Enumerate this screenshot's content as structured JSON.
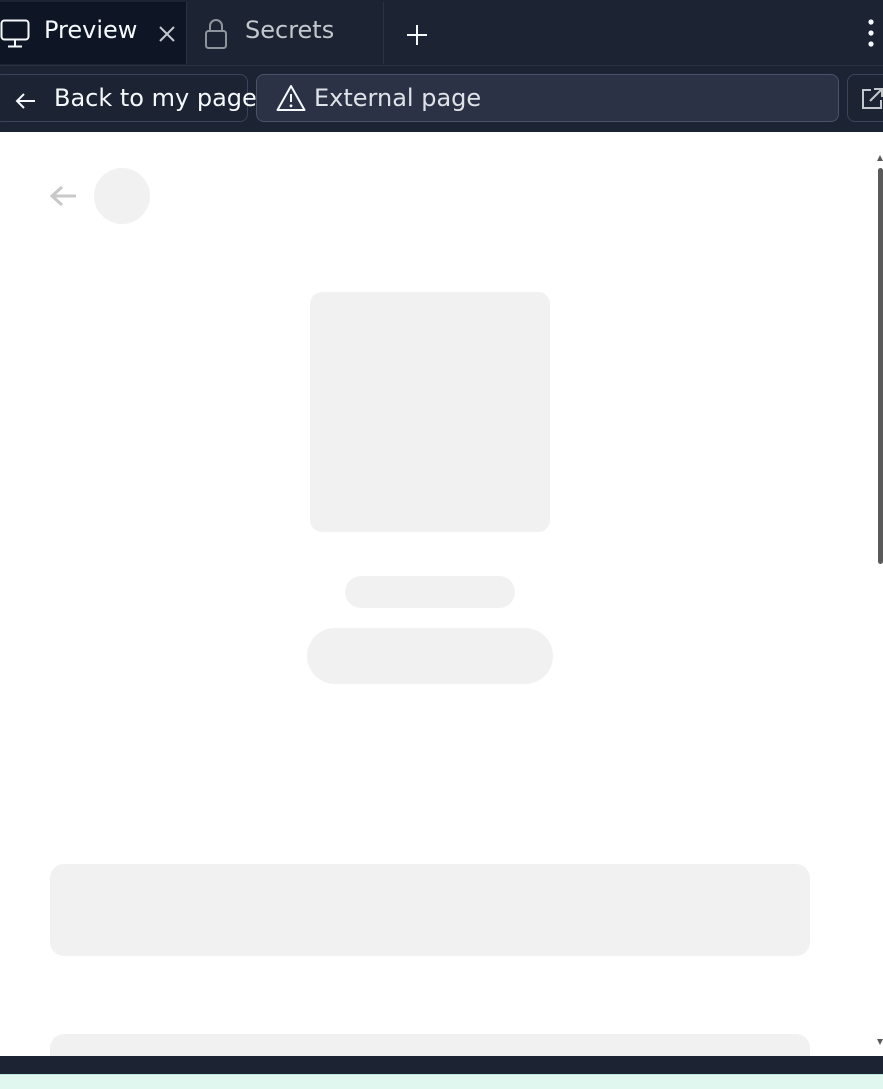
{
  "tabs": [
    {
      "label": "Preview",
      "icon": "monitor-icon",
      "active": true,
      "closable": true
    },
    {
      "label": "Secrets",
      "icon": "lock-icon",
      "active": false,
      "closable": false
    }
  ],
  "toolbar": {
    "back_label": "Back to my page",
    "url_label": "External page"
  },
  "colors": {
    "chrome_bg": "#1c2333",
    "active_tab_bg": "#0e1525",
    "url_bar_bg": "#2b3245",
    "skeleton": "#f1f1f1",
    "page_bg": "#ffffff"
  }
}
